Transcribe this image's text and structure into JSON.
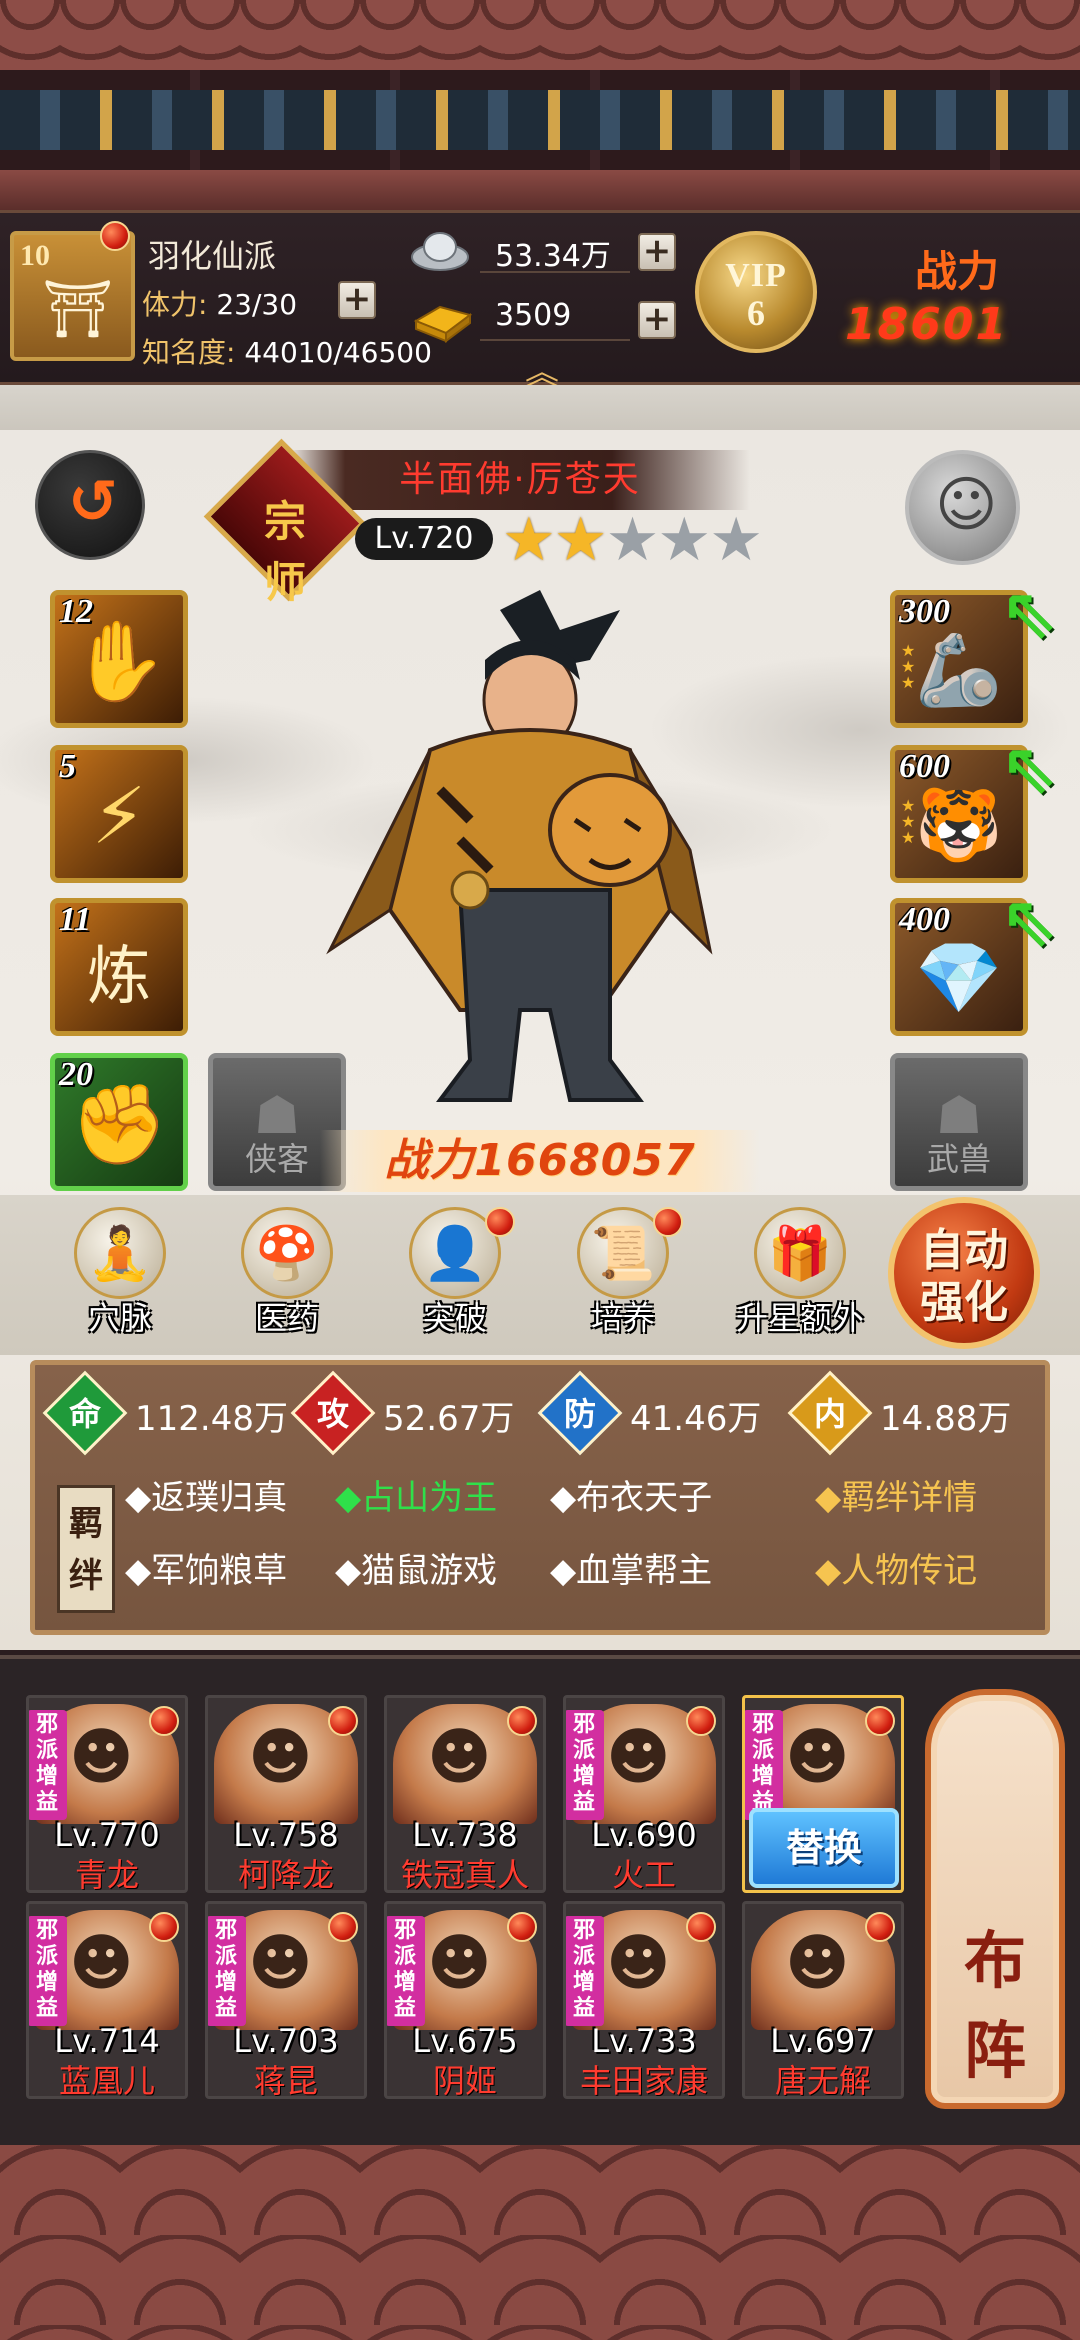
{
  "header": {
    "guild_level": "10",
    "guild_name": "羽化仙派",
    "stamina_label": "体力:",
    "stamina_value": "23/30",
    "fame_label": "知名度:",
    "fame_value": "44010/46500",
    "silver": "53.34万",
    "gold": "3509",
    "vip_label": "VIP",
    "vip_level": "6",
    "power_label": "战力",
    "power_value": "18601"
  },
  "hero": {
    "rank_badge": "宗师",
    "name": "半面佛·厉苍天",
    "level": "Lv.720",
    "stars_filled": 2,
    "stars_total": 5,
    "power": "战力1668057"
  },
  "skills": [
    {
      "count": "12",
      "icon": "palm-icon"
    },
    {
      "count": "5",
      "icon": "claw-icon"
    },
    {
      "count": "11",
      "icon": "refine-icon",
      "text": "炼"
    },
    {
      "count": "20",
      "icon": "fist-medal-icon"
    }
  ],
  "empty_slots": {
    "companion": "侠客",
    "beast": "武兽"
  },
  "equipment": [
    {
      "count": "300",
      "icon": "gauntlet-icon"
    },
    {
      "count": "600",
      "icon": "tiger-armor-icon"
    },
    {
      "count": "400",
      "icon": "gems-icon"
    }
  ],
  "actions": [
    {
      "label": "穴脉",
      "icon": "meridian-icon",
      "dot": false
    },
    {
      "label": "医药",
      "icon": "medicine-icon",
      "dot": false
    },
    {
      "label": "突破",
      "icon": "breakthrough-icon",
      "dot": true
    },
    {
      "label": "培养",
      "icon": "cultivate-icon",
      "dot": true
    },
    {
      "label": "升星额外",
      "icon": "star-up-icon",
      "dot": false
    }
  ],
  "auto_enhance": [
    "自动",
    "强化"
  ],
  "stats": [
    {
      "label": "命",
      "value": "112.48万",
      "color": "#1f9a3a"
    },
    {
      "label": "攻",
      "value": "52.67万",
      "color": "#c82222"
    },
    {
      "label": "防",
      "value": "41.46万",
      "color": "#2272c8"
    },
    {
      "label": "内",
      "value": "14.88万",
      "color": "#d89a1a"
    }
  ],
  "bond_label": "羁绊",
  "bonds_row1": [
    {
      "text": "◆返璞归真",
      "active": false
    },
    {
      "text": "◆占山为王",
      "active": true
    },
    {
      "text": "◆布衣天子",
      "active": false
    }
  ],
  "bonds_row2": [
    {
      "text": "◆军饷粮草",
      "active": false
    },
    {
      "text": "◆猫鼠游戏",
      "active": false
    },
    {
      "text": "◆血掌帮主",
      "active": false
    }
  ],
  "links": {
    "bond_detail": "◆羁绊详情",
    "biography": "◆人物传记"
  },
  "team_tag": "邪派增益",
  "team": [
    {
      "level": "Lv.770",
      "name": "青龙",
      "tag": true
    },
    {
      "level": "Lv.758",
      "name": "柯降龙",
      "tag": false
    },
    {
      "level": "Lv.738",
      "name": "铁冠真人",
      "tag": false
    },
    {
      "level": "Lv.690",
      "name": "火工",
      "tag": true
    },
    {
      "level": "",
      "name": "",
      "tag": true,
      "selected": true
    },
    {
      "level": "Lv.714",
      "name": "蓝凰儿",
      "tag": true
    },
    {
      "level": "Lv.703",
      "name": "蒋昆",
      "tag": true
    },
    {
      "level": "Lv.675",
      "name": "阴姬",
      "tag": true
    },
    {
      "level": "Lv.733",
      "name": "丰田家康",
      "tag": true
    },
    {
      "level": "Lv.697",
      "name": "唐无解",
      "tag": false
    }
  ],
  "replace_label": "替换",
  "deploy_label": [
    "布",
    "阵"
  ]
}
